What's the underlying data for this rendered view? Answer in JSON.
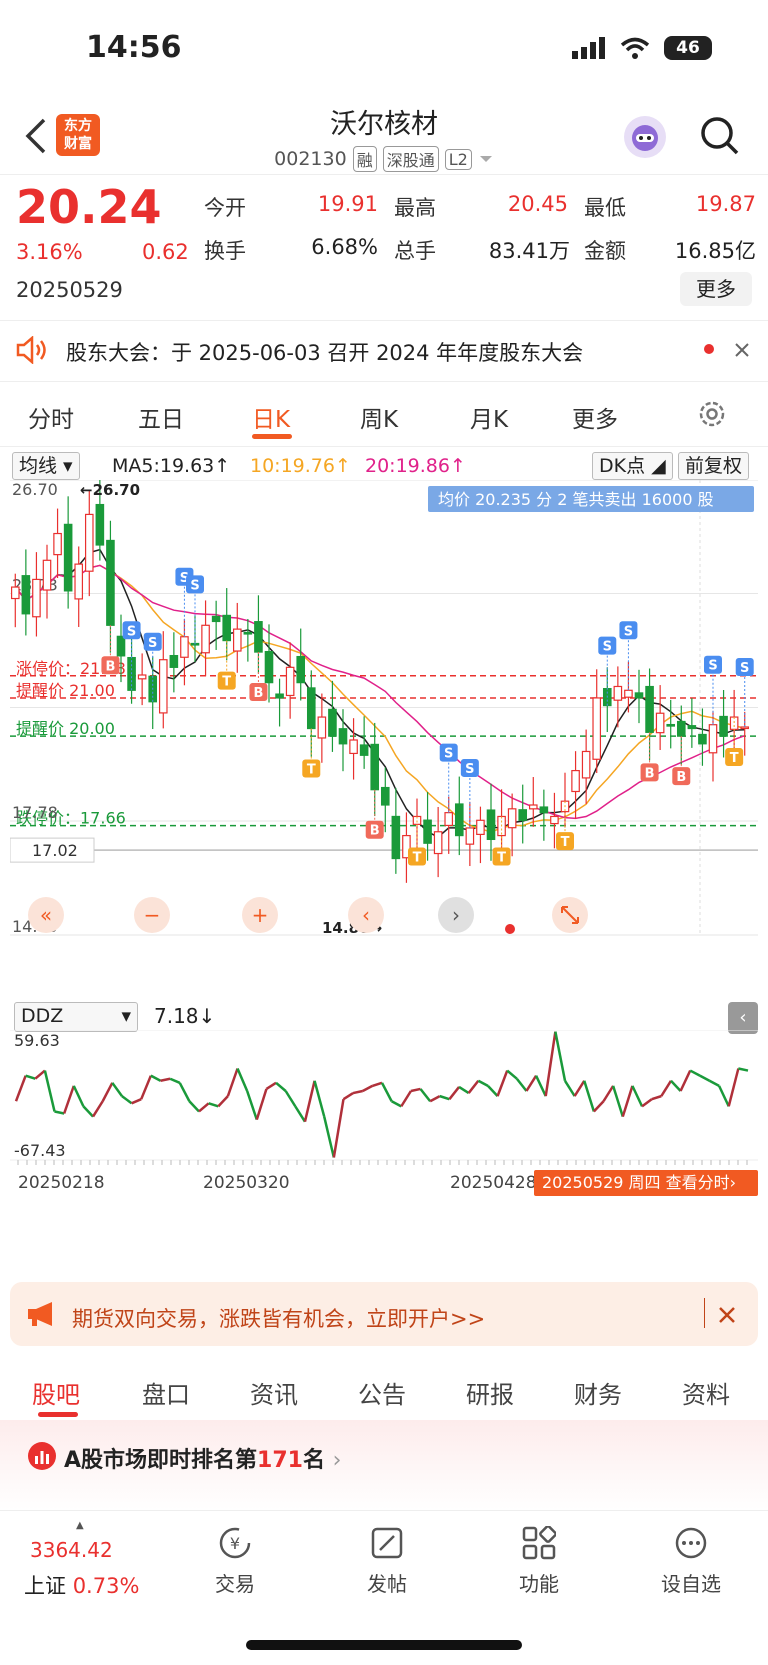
{
  "status": {
    "time": "14:56",
    "battery": "46"
  },
  "header": {
    "logo_line1": "东方",
    "logo_line2": "财富",
    "name": "沃尔核材",
    "code": "002130",
    "tags": [
      "融",
      "深股通",
      "L2"
    ]
  },
  "quote": {
    "price": "20.24",
    "pct": "3.16%",
    "change": "0.62",
    "date": "20250529",
    "open_label": "今开",
    "open": "19.91",
    "high_label": "最高",
    "high": "20.45",
    "low_label": "最低",
    "low": "19.87",
    "turnover_label": "换手",
    "turnover": "6.68%",
    "volume_label": "总手",
    "volume": "83.41万",
    "amount_label": "金额",
    "amount": "16.85亿",
    "more": "更多"
  },
  "notice": {
    "text": "股东大会：于 2025-06-03 召开 2024 年年度股东大会"
  },
  "ktabs": [
    "分时",
    "五日",
    "日K",
    "周K",
    "月K",
    "更多"
  ],
  "ma": {
    "select": "均线",
    "ma5": "MA5:19.63↑",
    "ma10": "10:19.76↑",
    "ma20": "20:19.86↑",
    "dk": "DK点",
    "adjust": "前复权"
  },
  "colors": {
    "up": "#e9302e",
    "down": "#1a9a3a",
    "ma5": "#222222",
    "ma10": "#f5a623",
    "ma20": "#e0218a",
    "accent": "#f15a22"
  },
  "chart_data": [
    {
      "type": "candlestick",
      "title": "",
      "ylim": [
        14.8,
        26.7
      ],
      "y_ticks": [
        "26.70",
        "23.73",
        "17.78",
        "14.80"
      ],
      "annotations": {
        "max_marker": "←26.70",
        "min_marker": "14.80→",
        "tooltip": "均价 20.235 分 2 笔共卖出 16000 股",
        "limit_up": "涨停价：21.58",
        "alert_1": "提醒价 21.00",
        "alert_2": "提醒价 20.00",
        "limit_down": "跌停价：17.66",
        "price_tag": "17.02"
      },
      "close": [
        23.9,
        23.2,
        24.1,
        24.6,
        25.3,
        23.8,
        24.5,
        25.8,
        25.0,
        22.9,
        22.1,
        21.2,
        21.6,
        20.9,
        22.0,
        21.8,
        22.6,
        22.4,
        22.9,
        23.0,
        22.5,
        22.8,
        22.7,
        22.2,
        21.4,
        21.0,
        21.8,
        21.4,
        20.2,
        20.5,
        20.0,
        19.8,
        19.9,
        19.5,
        18.6,
        18.2,
        16.8,
        17.4,
        17.9,
        17.2,
        17.5,
        18.0,
        17.4,
        17.6,
        17.8,
        17.3,
        17.9,
        18.1,
        17.8,
        18.2,
        18.0,
        17.9,
        18.3,
        19.1,
        19.6,
        21.0,
        20.8,
        21.3,
        21.2,
        21.0,
        20.1,
        20.6,
        20.3,
        20.0,
        20.2,
        19.8,
        20.3,
        20.0,
        20.5,
        20.24
      ],
      "ma_series": [
        {
          "name": "MA5",
          "color": "#222222"
        },
        {
          "name": "MA10",
          "color": "#f5a623"
        },
        {
          "name": "MA20",
          "color": "#e0218a"
        }
      ],
      "signals": {
        "buy": "B",
        "sell": "S",
        "t": "T"
      },
      "controls": [
        "«",
        "−",
        "+",
        "‹",
        "›"
      ]
    },
    {
      "type": "line",
      "title": "",
      "indicator": "DDZ",
      "current": "7.18↓",
      "ylim": [
        -67.43,
        59.63
      ],
      "y_ticks": [
        "59.63",
        "-67.43"
      ],
      "x_ticks": [
        "20250218",
        "20250320",
        "20250428"
      ],
      "values": [
        -10,
        15,
        12,
        20,
        -20,
        -22,
        5,
        -15,
        -25,
        -10,
        8,
        -5,
        -12,
        -8,
        15,
        10,
        12,
        8,
        -10,
        -20,
        -12,
        -15,
        -5,
        22,
        0,
        -28,
        2,
        8,
        0,
        -15,
        -30,
        10,
        -25,
        -65,
        -8,
        -2,
        0,
        5,
        8,
        -10,
        -15,
        0,
        2,
        -10,
        -5,
        -8,
        4,
        -2,
        10,
        5,
        -5,
        20,
        12,
        0,
        15,
        -5,
        58,
        10,
        -5,
        10,
        -20,
        -10,
        5,
        -25,
        5,
        -15,
        -8,
        -5,
        10,
        0,
        20,
        15,
        10,
        5,
        -15,
        22,
        20
      ],
      "cursor_label": "20250529 周四 查看分时"
    }
  ],
  "promo": {
    "text": "期货双向交易，涨跌皆有机会，立即开户>>"
  },
  "bottom_tabs": [
    "股吧",
    "盘口",
    "资讯",
    "公告",
    "研报",
    "财务",
    "资料"
  ],
  "rank": {
    "prefix": "A股市场即时排名第",
    "num": "171",
    "suffix": "名"
  },
  "nav": {
    "index_value": "3364.42",
    "index_name": "上证",
    "index_pct": "0.73%",
    "trade": "交易",
    "post": "发帖",
    "func": "功能",
    "watch": "设自选"
  }
}
